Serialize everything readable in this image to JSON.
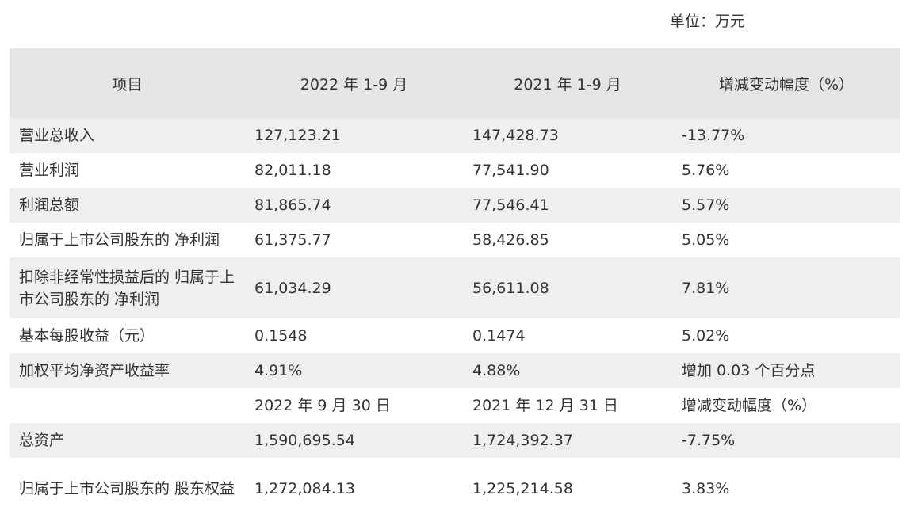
{
  "unit_label": "单位：万元",
  "header": [
    "项目",
    "2022 年 1-9 月",
    "2021 年 1-9 月",
    "增减变动幅度（%）"
  ],
  "rows": [
    {
      "item": "营业总收入",
      "v2022": "127,123.21",
      "v2021": "147,428.73",
      "change": "-13.77%"
    },
    {
      "item": "营业利润",
      "v2022": "82,011.18",
      "v2021": "77,541.90",
      "change": "5.76%"
    },
    {
      "item": "利润总额",
      "v2022": "81,865.74",
      "v2021": "77,546.41",
      "change": "5.57%"
    },
    {
      "item": "归属于上市公司股东的 净利润",
      "v2022": "61,375.77",
      "v2021": "58,426.85",
      "change": "5.05%"
    },
    {
      "item": "扣除非经常性损益后的 归属于上市公司股东的 净利润",
      "v2022": "61,034.29",
      "v2021": "56,611.08",
      "change": "7.81%"
    },
    {
      "item": "基本每股收益（元）",
      "v2022": "0.1548",
      "v2021": "0.1474",
      "change": "5.02%"
    },
    {
      "item": "加权平均净资产收益率",
      "v2022": "4.91%",
      "v2021": "4.88%",
      "change": "增加 0.03 个百分点"
    },
    {
      "item": "",
      "v2022": "2022 年 9 月 30 日",
      "v2021": "2021 年 12 月 31 日",
      "change": "增减变动幅度（%）"
    },
    {
      "item": "总资产",
      "v2022": "1,590,695.54",
      "v2021": "1,724,392.37",
      "change": "-7.75%"
    },
    {
      "item": "归属于上市公司股东的 股东权益",
      "v2022": "1,272,084.13",
      "v2021": "1,225,214.58",
      "change": "3.83%"
    }
  ]
}
